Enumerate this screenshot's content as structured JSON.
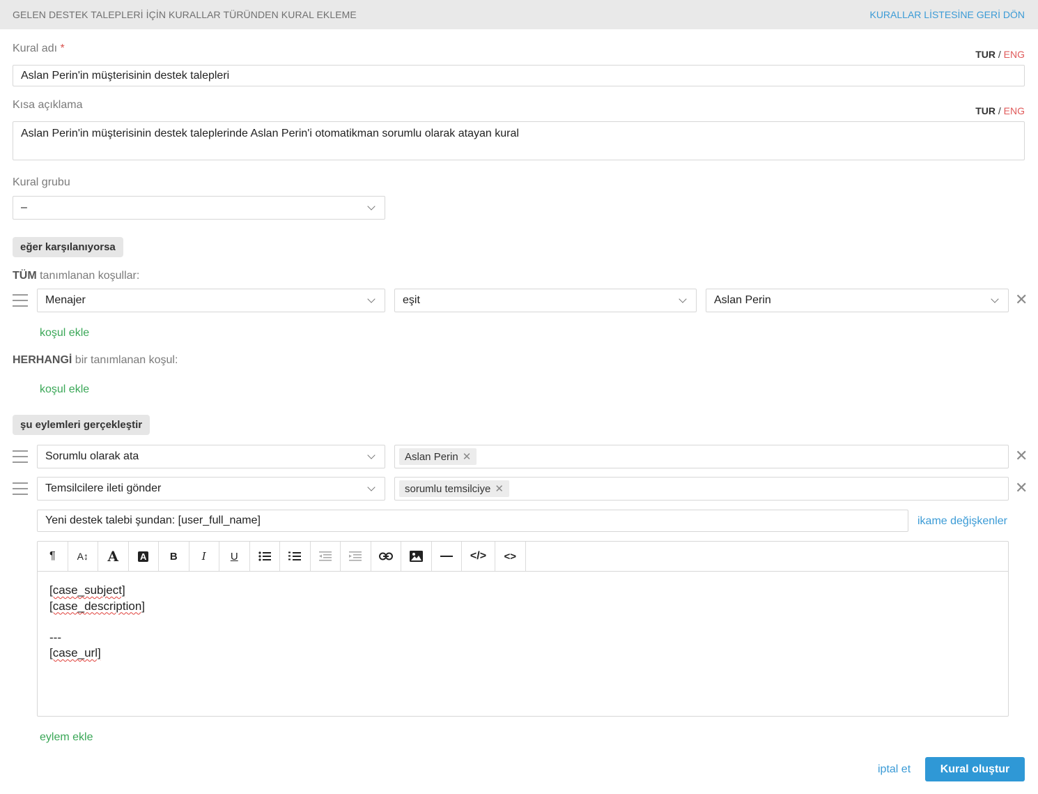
{
  "header": {
    "title": "GELEN DESTEK TALEPLERİ İÇİN KURALLAR TÜRÜNDEN KURAL EKLEME",
    "back_link": "KURALLAR LİSTESİNE GERİ DÖN"
  },
  "lang": {
    "tur": "TUR",
    "sep": "/",
    "eng": "ENG"
  },
  "rule_name": {
    "label": "Kural adı",
    "required": "*",
    "value": "Aslan Perin'in müşterisinin destek talepleri"
  },
  "short_desc": {
    "label": "Kısa açıklama",
    "value": "Aslan Perin'in müşterisinin destek taleplerinde Aslan Perin'i otomatikman sorumlu olarak atayan kural"
  },
  "rule_group": {
    "label": "Kural grubu",
    "value": "–"
  },
  "conditions": {
    "section_label": "eğer karşılanıyorsa",
    "all_bold": "TÜM",
    "all_rest": " tanımlanan koşullar:",
    "row": {
      "field": "Menajer",
      "operator": "eşit",
      "value": "Aslan Perin"
    },
    "add_label_all": "koşul ekle",
    "any_bold": "HERHANGİ",
    "any_rest": " bir tanımlanan koşul:",
    "add_label_any": "koşul ekle"
  },
  "actions": {
    "section_label": "şu eylemleri gerçekleştir",
    "row1": {
      "action": "Sorumlu olarak ata",
      "tag": "Aslan Perin"
    },
    "row2": {
      "action": "Temsilcilere ileti gönder",
      "tag": "sorumlu temsilciye"
    },
    "subject": "Yeni destek talebi şundan: [user_full_name]",
    "variables_link": "ikame değişkenler",
    "body": {
      "l1": "[case_subject]",
      "l2": "[case_description]",
      "l3": "---",
      "l4": "[case_url]"
    },
    "add_label": "eylem ekle"
  },
  "toolbar": {
    "paragraph": "¶",
    "font_size": "A↕",
    "font_color": "A",
    "bg_color": "A",
    "bold": "B",
    "italic": "I",
    "underline": "U",
    "bullet_list": "≔",
    "numbered_list": "≔",
    "outdent": "⇤",
    "indent": "⇥",
    "link": "⛓",
    "hr": "—",
    "code_view": "</>",
    "source": "<>"
  },
  "footer": {
    "cancel": "iptal et",
    "submit": "Kural oluştur"
  },
  "colors": {
    "accent": "#2f98d6",
    "green": "#3aa757",
    "red": "#e05a5a"
  }
}
